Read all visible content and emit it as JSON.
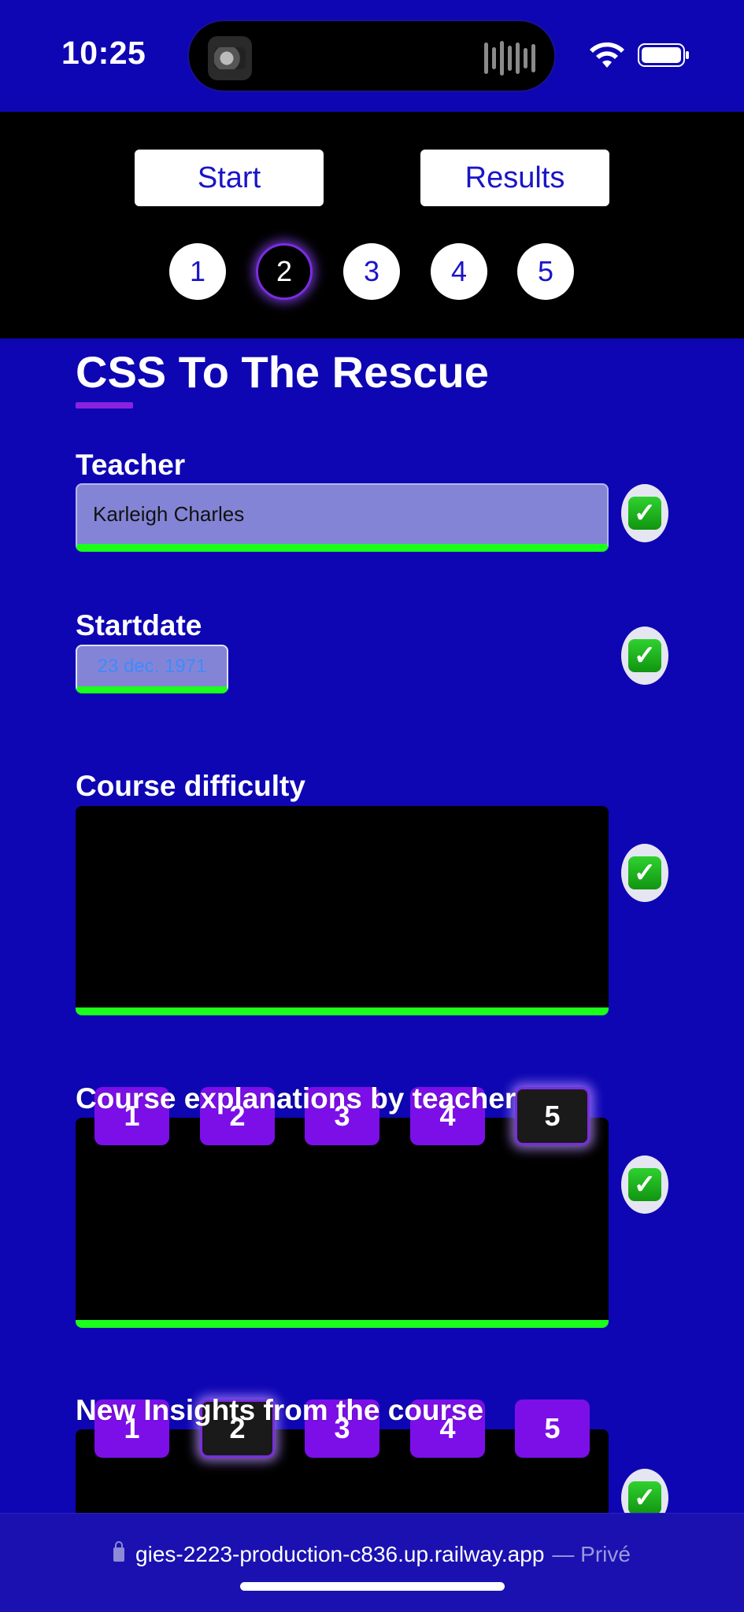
{
  "status_bar": {
    "time": "10:25"
  },
  "nav": {
    "start_label": "Start",
    "results_label": "Results",
    "steps": [
      "1",
      "2",
      "3",
      "4",
      "5"
    ],
    "active_step": "2"
  },
  "main": {
    "title": "CSS To The Rescue",
    "teacher": {
      "label": "Teacher",
      "value": "Karleigh Charles"
    },
    "startdate": {
      "label": "Startdate",
      "value": "23 dec. 1971"
    },
    "difficulty": {
      "label": "Course difficulty"
    },
    "explanations": {
      "label": "Course explanations by teacher",
      "ratings": [
        "1",
        "2",
        "3",
        "4",
        "5"
      ],
      "selected": "5"
    },
    "insights": {
      "label": "New Insights from the course",
      "ratings": [
        "1",
        "2",
        "3",
        "4",
        "5"
      ],
      "selected": "2"
    },
    "check_symbol": "✓"
  },
  "browser": {
    "url": "gies-2223-production-c836.up.railway.app",
    "private_label": "— Privé"
  },
  "colors": {
    "background": "#0e06b3",
    "accent": "#7c0fe8",
    "valid": "#1bff1b"
  }
}
